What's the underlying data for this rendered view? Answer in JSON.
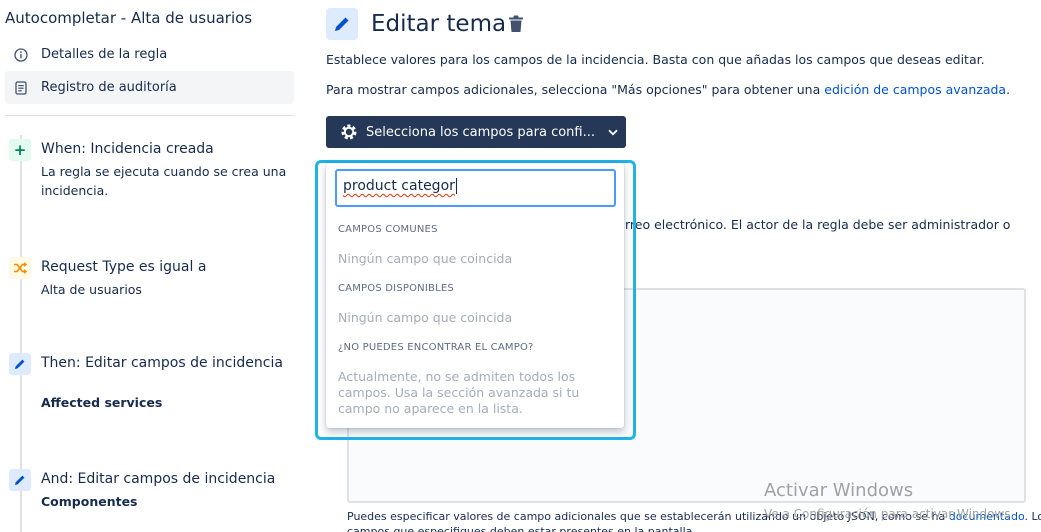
{
  "sidebar": {
    "rule_title": "Autocompletar - Alta de usuarios",
    "nav": [
      {
        "label": "Detalles de la regla",
        "icon": "info-icon"
      },
      {
        "label": "Registro de auditoría",
        "icon": "document-icon"
      }
    ],
    "steps": [
      {
        "icon": "plus-icon",
        "title": "When: Incidencia creada",
        "desc": "La regla se ejecuta cuando se crea una incidencia."
      },
      {
        "icon": "branch-icon",
        "title": "Request Type es igual a",
        "desc": "Alta de usuarios"
      },
      {
        "icon": "pencil-icon",
        "title": "Then: Editar campos de incidencia",
        "desc": "Affected services"
      },
      {
        "icon": "pencil-icon",
        "title": "And: Editar campos de incidencia",
        "desc": "Componentes"
      }
    ]
  },
  "main": {
    "title": "Editar tema",
    "desc1": "Establece valores para los campos de la incidencia. Basta con que añadas los campos que deseas editar.",
    "desc2_prefix": "Para mostrar campos adicionales, selecciona \"Más opciones\" para obtener una ",
    "desc2_link": "edición de campos avanzada",
    "desc2_suffix": ".",
    "select_button_label": "Selecciona los campos para confi...",
    "bg_partial_text": "rreo electrónico. El actor de la regla debe ser administrador o",
    "footnote_line1_prefix": "Puedes especificar valores de campo adicionales que se establecerán utilizando un objeto JSON, como se ha ",
    "footnote_link": "documentado",
    "footnote_line1_suffix": ". Los",
    "footnote_line2": "campos que especifiques deben estar presentes en la pantalla."
  },
  "dropdown": {
    "search_value": "product categor",
    "common_heading": "CAMPOS COMUNES",
    "common_empty": "Ningún campo que coincida",
    "available_heading": "CAMPOS DISPONIBLES",
    "available_empty": "Ningún campo que coincida",
    "help_heading": "¿NO PUEDES ENCONTRAR EL CAMPO?",
    "help_text": "Actualmente, no se admiten todos los campos. Usa la sección avanzada si tu campo no aparece en la lista."
  },
  "watermark": {
    "title": "Activar Windows",
    "subtitle": "Ve a Configuración para activar Windows."
  },
  "colors": {
    "primary_button": "#253858",
    "link": "#0052cc",
    "focus_ring": "#1fb3e6"
  }
}
